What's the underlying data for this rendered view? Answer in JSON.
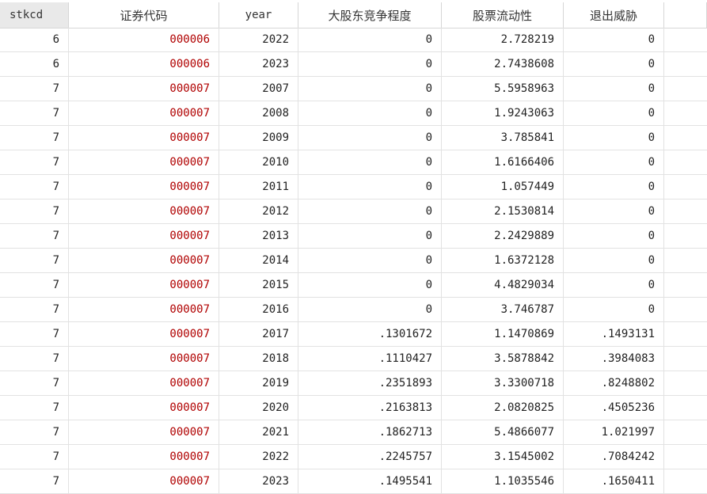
{
  "table": {
    "columns": [
      "stkcd",
      "证券代码",
      "year",
      "大股东竞争程度",
      "股票流动性",
      "退出威胁"
    ],
    "rows": [
      [
        "6",
        "000006",
        "2022",
        "0",
        "2.728219",
        "0"
      ],
      [
        "6",
        "000006",
        "2023",
        "0",
        "2.7438608",
        "0"
      ],
      [
        "7",
        "000007",
        "2007",
        "0",
        "5.5958963",
        "0"
      ],
      [
        "7",
        "000007",
        "2008",
        "0",
        "1.9243063",
        "0"
      ],
      [
        "7",
        "000007",
        "2009",
        "0",
        "3.785841",
        "0"
      ],
      [
        "7",
        "000007",
        "2010",
        "0",
        "1.6166406",
        "0"
      ],
      [
        "7",
        "000007",
        "2011",
        "0",
        "1.057449",
        "0"
      ],
      [
        "7",
        "000007",
        "2012",
        "0",
        "2.1530814",
        "0"
      ],
      [
        "7",
        "000007",
        "2013",
        "0",
        "2.2429889",
        "0"
      ],
      [
        "7",
        "000007",
        "2014",
        "0",
        "1.6372128",
        "0"
      ],
      [
        "7",
        "000007",
        "2015",
        "0",
        "4.4829034",
        "0"
      ],
      [
        "7",
        "000007",
        "2016",
        "0",
        "3.746787",
        "0"
      ],
      [
        "7",
        "000007",
        "2017",
        ".1301672",
        "1.1470869",
        ".1493131"
      ],
      [
        "7",
        "000007",
        "2018",
        ".1110427",
        "3.5878842",
        ".3984083"
      ],
      [
        "7",
        "000007",
        "2019",
        ".2351893",
        "3.3300718",
        ".8248802"
      ],
      [
        "7",
        "000007",
        "2020",
        ".2163813",
        "2.0820825",
        ".4505236"
      ],
      [
        "7",
        "000007",
        "2021",
        ".1862713",
        "5.4866077",
        "1.021997"
      ],
      [
        "7",
        "000007",
        "2022",
        ".2245757",
        "3.1545002",
        ".7084242"
      ],
      [
        "7",
        "000007",
        "2023",
        ".1495541",
        "1.1035546",
        ".1650411"
      ]
    ]
  },
  "colors": {
    "code_text": "#b00000",
    "selected_header_bg": "#e9e9e9",
    "gridline": "#e2e2e2"
  }
}
